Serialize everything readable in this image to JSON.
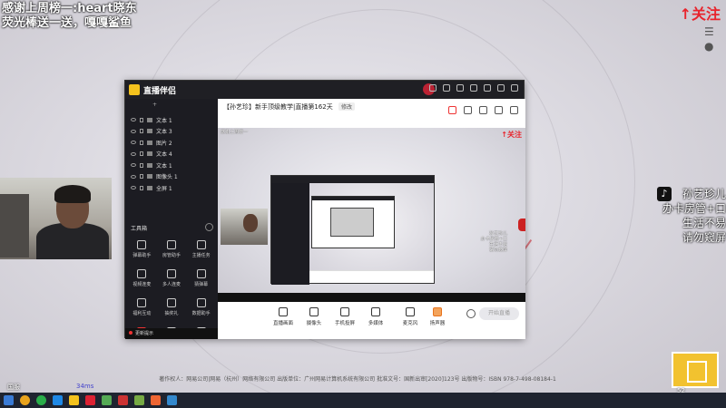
{
  "overlay": {
    "line1": "感谢上周榜一:heart晓东",
    "line2": "荧光棒送一送，嘎嘎鲨鱼",
    "follow": "↑关注"
  },
  "tiktok": {
    "logo": "♪",
    "lines": [
      "孙艺珍儿",
      "办卡房管+口",
      "生活不易",
      "请勿窥屏"
    ]
  },
  "app": {
    "title": "直播伴侣",
    "version": "",
    "left_tabs": [
      "",
      "",
      ""
    ],
    "scenes": [
      "文本 1",
      "文本 3",
      "图片 2",
      "文本 4",
      "文本 1",
      "图像头 1",
      "全屏 1"
    ],
    "toolbox_title": "工具箱",
    "tools": [
      "弹幕助手",
      "房管助手",
      "主播任务",
      "视频连麦",
      "多人连麦",
      "猜弹幕",
      "福利互动",
      "抽奖礼",
      "数据助手",
      "",
      "",
      ""
    ],
    "notice": "更新提示",
    "stream_title": "【孙艺珍】新手顶级教学|直播第162天",
    "edit_label": "修改",
    "meta_tag": "",
    "main_icons": [
      "",
      "",
      "",
      "",
      ""
    ],
    "mini_overlay": "感谢上周榜一",
    "mini_follow": "↑关注",
    "bottom_items": [
      "直播画面",
      "摄像头",
      "手机投屏",
      "多媒体",
      "麦克风",
      "扬声器"
    ],
    "go_live": "开始直播"
  },
  "footer": {
    "watermark": "",
    "copyright": "著作权人：网易公司|网易（杭州）网络有限公司 出版单位：广州网易计算机系统有限公司 批准文号：国新出审[2020]123号 出版物号：ISBN 978-7-498-08184-1",
    "ms": "34ms",
    "bottom_left": "国服",
    "stats": "52"
  },
  "taskbar": {
    "time": "",
    "date": ""
  },
  "colors": {
    "accent_red": "#e8242c",
    "app_dark": "#1c1c22",
    "taskbar": "#1f2430"
  }
}
